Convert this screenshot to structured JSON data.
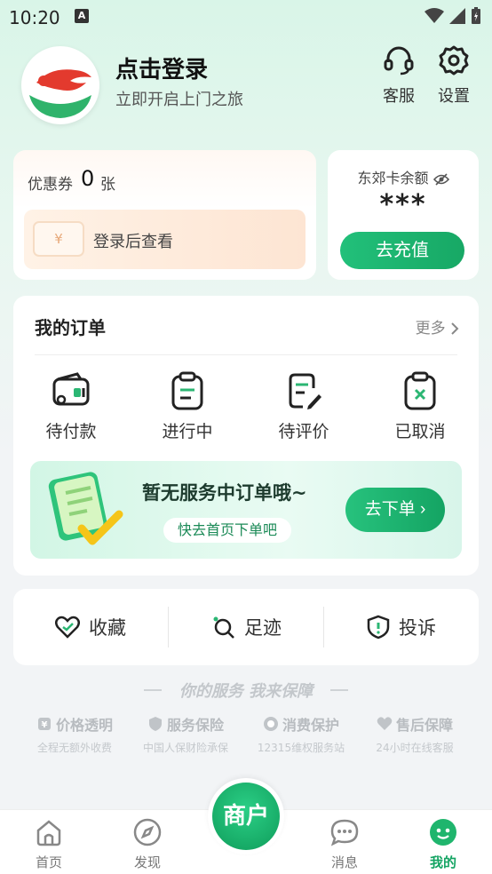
{
  "status": {
    "time": "10:20",
    "notif": "A"
  },
  "header": {
    "title": "点击登录",
    "subtitle": "立即开启上门之旅",
    "service_label": "客服",
    "settings_label": "设置"
  },
  "coupon": {
    "label": "优惠券",
    "count": "0",
    "unit": "张",
    "view_text": "登录后查看",
    "ticket_symbol": "¥"
  },
  "balance": {
    "label": "东郊卡余额",
    "value": "***",
    "recharge_label": "去充值"
  },
  "orders": {
    "title": "我的订单",
    "more": "更多",
    "items": [
      {
        "label": "待付款",
        "icon": "wallet-icon"
      },
      {
        "label": "进行中",
        "icon": "clipboard-icon"
      },
      {
        "label": "待评价",
        "icon": "review-icon"
      },
      {
        "label": "已取消",
        "icon": "cancel-icon"
      }
    ],
    "empty": {
      "title": "暂无服务中订单哦~",
      "subtitle": "快去首页下单吧",
      "button": "去下单 ›"
    }
  },
  "actions": [
    {
      "label": "收藏",
      "icon": "heart-icon"
    },
    {
      "label": "足迹",
      "icon": "footprint-icon"
    },
    {
      "label": "投诉",
      "icon": "shield-alert-icon"
    }
  ],
  "guarantee": {
    "title": "你的服务 我来保障",
    "items": [
      {
        "title": "价格透明",
        "sub": "全程无额外收费",
        "icon": "price-icon"
      },
      {
        "title": "服务保险",
        "sub": "中国人保财险承保",
        "icon": "insurance-icon"
      },
      {
        "title": "消费保护",
        "sub": "12315维权服务站",
        "icon": "protect-icon"
      },
      {
        "title": "售后保障",
        "sub": "24小时在线客服",
        "icon": "aftersale-icon"
      }
    ]
  },
  "tabbar": {
    "tabs": [
      {
        "label": "首页",
        "icon": "home-icon"
      },
      {
        "label": "发现",
        "icon": "compass-icon"
      },
      {
        "label": "消息",
        "icon": "message-icon"
      },
      {
        "label": "我的",
        "icon": "profile-icon"
      }
    ],
    "merchant_label": "商户",
    "active_tab": "我的"
  },
  "colors": {
    "brand_green": "#14a463",
    "accent_orange": "#e7a97a"
  }
}
